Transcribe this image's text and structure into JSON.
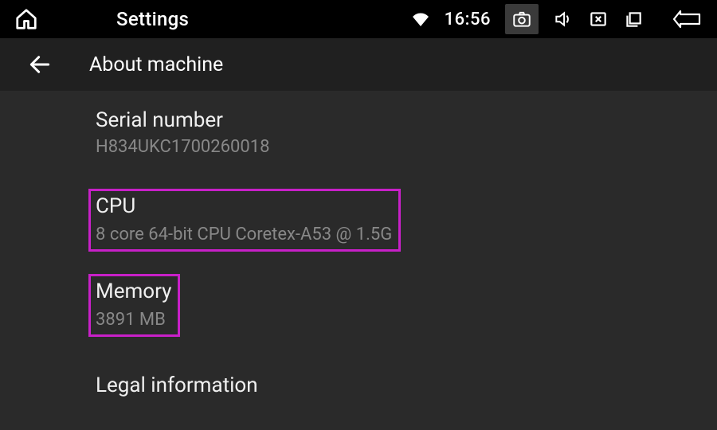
{
  "statusbar": {
    "app_title": "Settings",
    "time": "16:56"
  },
  "subheader": {
    "title": "About machine"
  },
  "items": {
    "serial": {
      "title": "Serial number",
      "value": "H834UKC1700260018"
    },
    "cpu": {
      "title": "CPU",
      "value": "8 core 64-bit CPU Coretex-A53 @ 1.5G"
    },
    "memory": {
      "title": "Memory",
      "value": "3891 MB"
    },
    "legal": {
      "title": "Legal information"
    }
  }
}
